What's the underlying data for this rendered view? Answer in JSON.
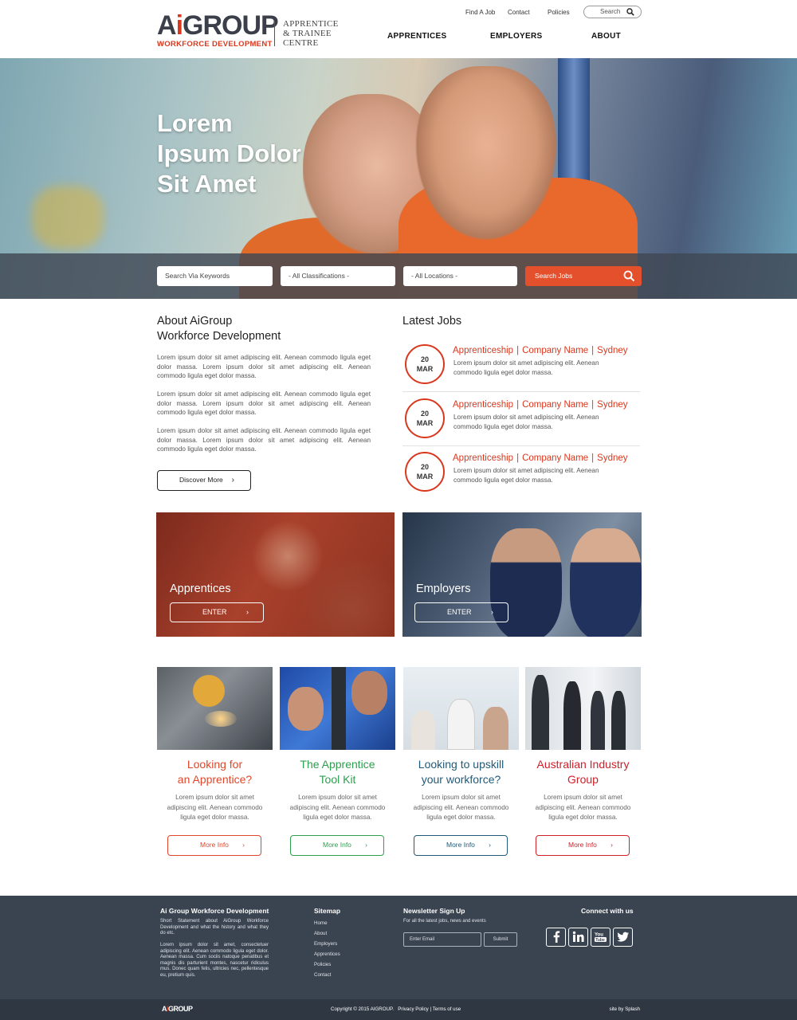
{
  "brand": {
    "logo_main_a": "A",
    "logo_main_i": "i",
    "logo_main_rest": "GROUP",
    "logo_sub": "WORKFORCE DEVELOPMENT",
    "centre_line1": "APPRENTICE",
    "centre_line2": "& TRAINEE",
    "centre_line3": "CENTRE"
  },
  "top_links": [
    "Find A Job",
    "Contact",
    "Policies"
  ],
  "top_search": {
    "placeholder": "Search"
  },
  "main_nav": [
    "APPRENTICES",
    "EMPLOYERS",
    "ABOUT"
  ],
  "hero": {
    "title_line1": "Lorem",
    "title_line2": "Ipsum Dolor",
    "title_line3": "Sit Amet"
  },
  "job_search": {
    "keywords_placeholder": "Search Via Keywords",
    "classifications_value": "- All Classifications -",
    "locations_value": "- All Locations -",
    "button_label": "Search Jobs"
  },
  "about": {
    "heading_line1": "About AiGroup",
    "heading_line2": "Workforce Development",
    "paragraphs": [
      "Lorem ipsum dolor sit amet adipiscing elit. Aenean commodo ligula eget dolor massa. Lorem ipsum dolor sit amet adipiscing elit. Aenean commodo ligula eget dolor massa.",
      "Lorem ipsum dolor sit amet adipiscing elit. Aenean commodo ligula eget dolor massa. Lorem ipsum dolor sit amet adipiscing elit. Aenean commodo ligula eget dolor massa.",
      "Lorem ipsum dolor sit amet adipiscing elit. Aenean commodo ligula eget dolor massa. Lorem ipsum dolor sit amet adipiscing elit. Aenean commodo ligula eget dolor massa."
    ],
    "button_label": "Discover More"
  },
  "latest_jobs": {
    "heading": "Latest Jobs",
    "items": [
      {
        "day": "20",
        "month": "MAR",
        "type": "Apprenticeship",
        "company": "Company Name",
        "location": "Sydney",
        "description": "Lorem ipsum dolor sit amet adipiscing elit. Aenean commodo ligula eget dolor massa."
      },
      {
        "day": "20",
        "month": "MAR",
        "type": "Apprenticeship",
        "company": "Company Name",
        "location": "Sydney",
        "description": "Lorem ipsum dolor sit amet adipiscing elit. Aenean commodo ligula eget dolor massa."
      },
      {
        "day": "20",
        "month": "MAR",
        "type": "Apprenticeship",
        "company": "Company Name",
        "location": "Sydney",
        "description": "Lorem ipsum dolor sit amet adipiscing elit. Aenean commodo ligula eget dolor massa."
      }
    ]
  },
  "panels": {
    "apprentices": {
      "title": "Apprentices",
      "button": "ENTER"
    },
    "employers": {
      "title": "Employers",
      "button": "ENTER"
    }
  },
  "cards": [
    {
      "title_line1": "Looking for",
      "title_line2": "an Apprentice?",
      "description": "Lorem ipsum dolor sit amet adipiscing elit. Aenean commodo ligula eget dolor massa.",
      "button": "More Info",
      "color": "#e0472a"
    },
    {
      "title_line1": "The Apprentice",
      "title_line2": "Tool Kit",
      "description": "Lorem ipsum dolor sit amet adipiscing elit. Aenean commodo ligula eget dolor massa.",
      "button": "More Info",
      "color": "#2e9e4f"
    },
    {
      "title_line1": "Looking to upskill",
      "title_line2": "your workforce?",
      "description": "Lorem ipsum dolor sit amet adipiscing elit. Aenean commodo ligula eget dolor massa.",
      "button": "More Info",
      "color": "#1f5a78"
    },
    {
      "title_line1": "Australian Industry",
      "title_line2": "Group",
      "description": "Lorem ipsum dolor sit amet adipiscing elit. Aenean commodo ligula eget dolor massa.",
      "button": "More Info",
      "color": "#d0202a"
    }
  ],
  "footer": {
    "about_heading": "Ai Group Workforce Development",
    "about_text1": "Short Statement about AiGroup Workforce Development and what the history and what they do etc.",
    "about_text2": "Lorem ipsum dolor sit amet, consectetuer adipiscing elit. Aenean commodo ligula eget dolor. Aenean massa. Cum sociis natoque penatibus et magnis dis parturient montes, nascetur ridiculus mus. Donec quam felis, ultricies nec, pellentesque eu, pretium quis.",
    "sitemap_heading": "Sitemap",
    "sitemap_links": [
      "Home",
      "About",
      "Employers",
      "Apprentices",
      "Policies",
      "Contact"
    ],
    "newsletter_heading": "Newsletter Sign Up",
    "newsletter_sub": "For all the latest jobs, news and events",
    "email_placeholder": "Enter Email",
    "submit_label": "Submit",
    "connect_heading": "Connect with us",
    "social_icons": [
      "facebook-icon",
      "linkedin-icon",
      "youtube-icon",
      "twitter-icon"
    ]
  },
  "bottom": {
    "copyright": "Copyright © 2015 AIGROUP.",
    "privacy": "Privacy Policy",
    "separator": "|",
    "terms": "Terms of use",
    "credit": "site by Splash"
  },
  "colors": {
    "accent": "#d9381e",
    "dark_footer": "#3a4350",
    "search_button": "#e5502c"
  }
}
